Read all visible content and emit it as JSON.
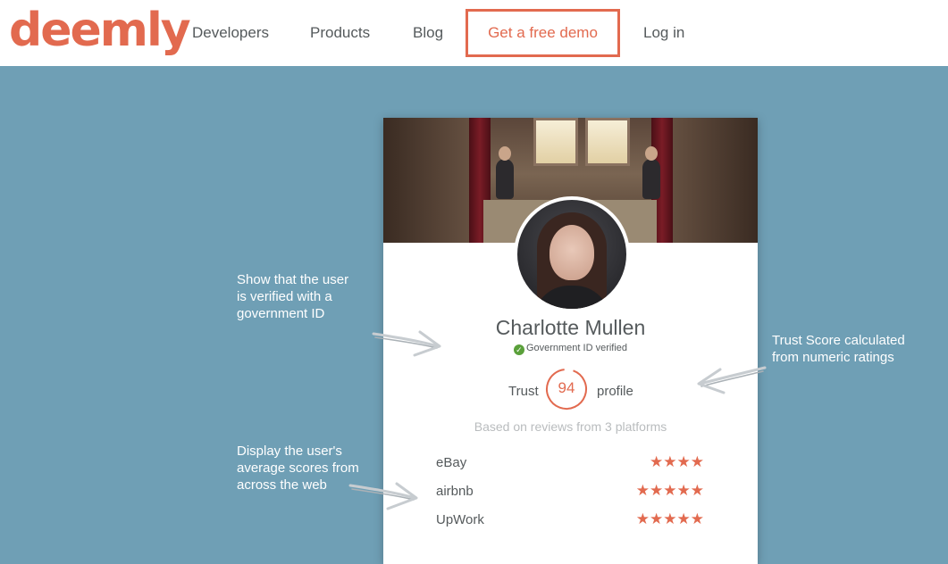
{
  "header": {
    "logo": "deemly",
    "nav": [
      "Developers",
      "Products",
      "Blog"
    ],
    "demo_button": "Get a free demo",
    "login": "Log in"
  },
  "profile": {
    "name": "Charlotte Mullen",
    "verified_text": "Government ID verified",
    "trust_prefix": "Trust",
    "trust_score": "94",
    "trust_suffix": "profile",
    "based_on": "Based on reviews from 3 platforms",
    "platforms": [
      {
        "name": "eBay",
        "stars": "★★★★",
        "rating": 4
      },
      {
        "name": "airbnb",
        "stars": "★★★★★",
        "rating": 5
      },
      {
        "name": "UpWork",
        "stars": "★★★★★",
        "rating": 5
      }
    ]
  },
  "annotations": {
    "verified_note": [
      "Show that the user",
      "is verified with a",
      "government ID"
    ],
    "trust_note": [
      "Trust Score calculated",
      "from numeric ratings"
    ],
    "scores_note": [
      "Display the user's",
      "average scores from",
      "across the web"
    ]
  },
  "colors": {
    "brand": "#e26a4f",
    "background": "#6f9fb5",
    "verified_badge": "#5aa03a"
  }
}
